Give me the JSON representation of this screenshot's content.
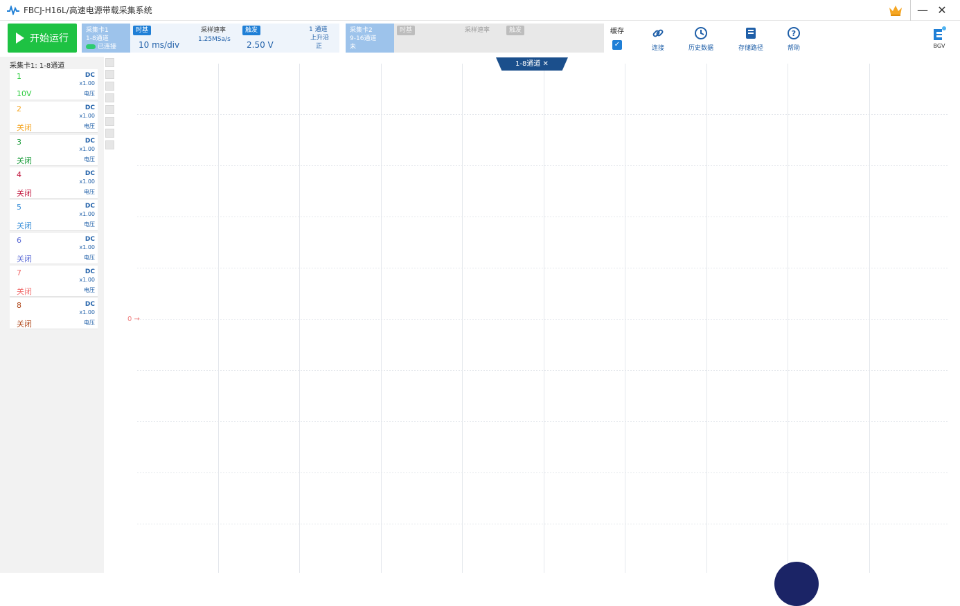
{
  "titlebar": {
    "title": "FBCJ-H16L/高速电源带载采集系统",
    "min_label": "—",
    "close_label": "✕"
  },
  "toolbar": {
    "start_label": "开始运行",
    "card1": {
      "head_line1": "采集卡1",
      "head_line2": "1-8通道",
      "head_line3": "已连接",
      "timebase_tag": "时基",
      "timebase_value": "10 ms/div",
      "sample_rate_label": "采样速率",
      "sample_rate_value": "1.25MSa/s",
      "trigger_tag": "触发",
      "trigger_value": "2.50 V",
      "trigger_side_1": "1 通道",
      "trigger_side_2": "上升沿",
      "trigger_side_3": "正"
    },
    "card2": {
      "head_line1": "采集卡2",
      "head_line2": "9-16通道",
      "head_line3": "未",
      "timebase_tag": "时基",
      "sample_rate_label": "采样速率",
      "trigger_tag": "触发"
    },
    "cache_label": "缓存",
    "cache_check": "✓",
    "tools": [
      {
        "label": "连接"
      },
      {
        "label": "历史数据"
      },
      {
        "label": "存储路径"
      },
      {
        "label": "帮助"
      }
    ],
    "logo_label": "BGV"
  },
  "sidebar": {
    "title": "采集卡1: 1-8通道",
    "channels": [
      {
        "num": "1",
        "status": "10V",
        "dc": "DC",
        "gain": "x1.00",
        "mode": "电压",
        "color": "#2ecc40"
      },
      {
        "num": "2",
        "status": "关闭",
        "dc": "DC",
        "gain": "x1.00",
        "mode": "电压",
        "color": "#f5a623"
      },
      {
        "num": "3",
        "status": "关闭",
        "dc": "DC",
        "gain": "x1.00",
        "mode": "电压",
        "color": "#1a9b3a"
      },
      {
        "num": "4",
        "status": "关闭",
        "dc": "DC",
        "gain": "x1.00",
        "mode": "电压",
        "color": "#c0143c"
      },
      {
        "num": "5",
        "status": "关闭",
        "dc": "DC",
        "gain": "x1.00",
        "mode": "电压",
        "color": "#3a8fd8"
      },
      {
        "num": "6",
        "status": "关闭",
        "dc": "DC",
        "gain": "x1.00",
        "mode": "电压",
        "color": "#5b6bd6"
      },
      {
        "num": "7",
        "status": "关闭",
        "dc": "DC",
        "gain": "x1.00",
        "mode": "电压",
        "color": "#f06b6b"
      },
      {
        "num": "8",
        "status": "关闭",
        "dc": "DC",
        "gain": "x1.00",
        "mode": "电压",
        "color": "#b04a1e"
      }
    ]
  },
  "plot": {
    "tab_label": "1-8通道  ✕",
    "zero_marker": "0 →"
  }
}
